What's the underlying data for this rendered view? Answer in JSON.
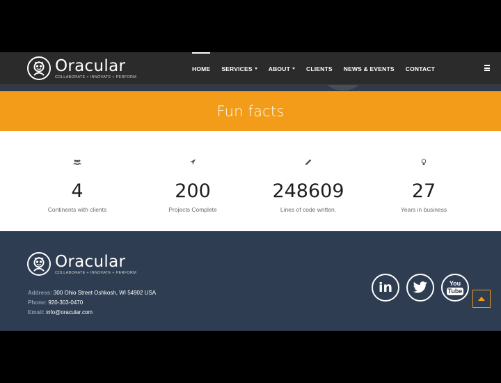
{
  "brand": {
    "name": "Oracular",
    "tagline": "COLLABORATE + INNOVATE + PERFORM",
    "logo_icon": "mascot-face-icon"
  },
  "nav": {
    "items": [
      {
        "label": "HOME",
        "active": true,
        "dropdown": false
      },
      {
        "label": "SERVICES",
        "active": false,
        "dropdown": true
      },
      {
        "label": "ABOUT",
        "active": false,
        "dropdown": true
      },
      {
        "label": "CLIENTS",
        "active": false,
        "dropdown": false
      },
      {
        "label": "NEWS & EVENTS",
        "active": false,
        "dropdown": false
      },
      {
        "label": "CONTACT",
        "active": false,
        "dropdown": false
      }
    ],
    "menu_icon": "hamburger-icon"
  },
  "funfacts": {
    "title": "Fun facts",
    "items": [
      {
        "icon": "users-icon",
        "number": "4",
        "label": "Continents with clients"
      },
      {
        "icon": "location-arrow-icon",
        "number": "200",
        "label": "Projects Complete"
      },
      {
        "icon": "pencil-icon",
        "number": "248609",
        "label": "Lines of code written."
      },
      {
        "icon": "lightbulb-icon",
        "number": "27",
        "label": "Years in business"
      }
    ]
  },
  "footer": {
    "address_label": "Address:",
    "address": "300 Ohio Street Oshkosh, WI 54902 USA",
    "phone_label": "Phone:",
    "phone": "920-303-0470",
    "email_label": "Email:",
    "email": "info@oracular.com",
    "social": [
      {
        "name": "linkedin-icon",
        "text": "in"
      },
      {
        "name": "twitter-icon",
        "text": ""
      },
      {
        "name": "youtube-icon",
        "text_top": "You",
        "text_bottom": "Tube"
      }
    ],
    "back_to_top_icon": "arrow-up-icon"
  },
  "colors": {
    "accent": "#f39c1a",
    "navbar": "#2b2b2b",
    "footer": "#2e3d51"
  }
}
